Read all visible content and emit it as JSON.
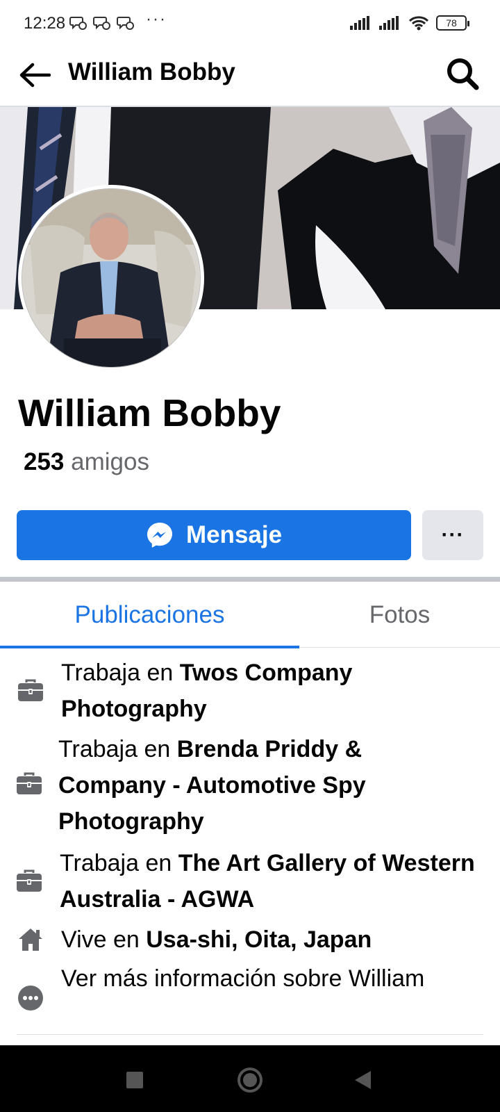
{
  "status_bar": {
    "time": "12:28",
    "more_dots": "···",
    "battery": "78",
    "notification_icons": [
      "chat-bubble-icon",
      "chat-bubble-icon",
      "chat-bubble-icon"
    ]
  },
  "app_bar": {
    "title": "William Bobby"
  },
  "profile": {
    "name": "William Bobby",
    "friends_count": "253",
    "friends_label": "amigos",
    "message_button": "Mensaje",
    "more_button": "···"
  },
  "tabs": [
    {
      "label": "Publicaciones",
      "active": true
    },
    {
      "label": "Fotos",
      "active": false
    }
  ],
  "info": [
    {
      "icon": "briefcase-icon",
      "prefix": "Trabaja en ",
      "value": "Twos Company Photography"
    },
    {
      "icon": "briefcase-icon",
      "prefix": "Trabaja en ",
      "value": "Brenda Priddy & Company - Automotive Spy Photography"
    },
    {
      "icon": "briefcase-icon",
      "prefix": "Trabaja en ",
      "value": "The Art Gallery of Western Australia - AGWA"
    },
    {
      "icon": "home-icon",
      "prefix": "Vive en ",
      "value": "Usa-shi, Oita, Japan"
    },
    {
      "icon": "more-circle-icon",
      "prefix": "",
      "value": "Ver más información sobre William"
    }
  ],
  "colors": {
    "accent": "#1b74e4",
    "secondary_text": "#65676b",
    "secondary_button": "#e4e6eb"
  }
}
